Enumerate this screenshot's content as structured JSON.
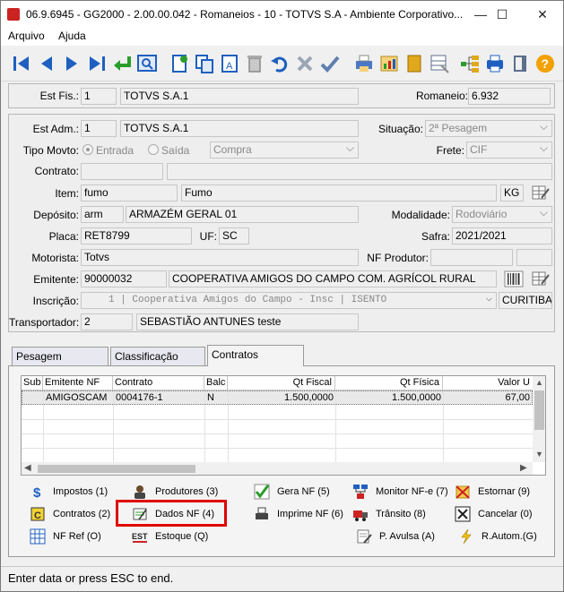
{
  "window": {
    "title": "06.9.6945 - GG2000 - 2.00.00.042 - Romaneios - 10 - TOTVS S.A - Ambiente Corporativo...",
    "minimize": "—",
    "maximize": "☐",
    "close": "✕"
  },
  "menu": {
    "arquivo": "Arquivo",
    "ajuda": "Ajuda"
  },
  "header": {
    "est_fis_label": "Est Fis.:",
    "est_fis_code": "1",
    "est_fis_name": "TOTVS S.A.1",
    "romaneio_label": "Romaneio:",
    "romaneio_value": "6.932"
  },
  "form": {
    "est_adm_label": "Est Adm.:",
    "est_adm_code": "1",
    "est_adm_name": "TOTVS S.A.1",
    "situacao_label": "Situação:",
    "situacao_value": "2ª Pesagem",
    "tipo_movto_label": "Tipo Movto:",
    "entrada_label": "Entrada",
    "saida_label": "Saída",
    "tipo_value": "Compra",
    "frete_label": "Frete:",
    "frete_value": "CIF",
    "contrato_label": "Contrato:",
    "item_label": "Item:",
    "item_code": "fumo",
    "item_name": "Fumo",
    "item_unit": "KG",
    "deposito_label": "Depósito:",
    "deposito_code": "arm",
    "deposito_name": "ARMAZÉM GERAL 01",
    "modalidade_label": "Modalidade:",
    "modalidade_value": "Rodoviário",
    "placa_label": "Placa:",
    "placa_value": "RET8799",
    "uf_label": "UF:",
    "uf_value": "SC",
    "safra_label": "Safra:",
    "safra_value": "2021/2021",
    "motorista_label": "Motorista:",
    "motorista_value": "Totvs",
    "nf_produtor_label": "NF Produtor:",
    "emitente_label": "Emitente:",
    "emitente_code": "90000032",
    "emitente_name": "COOPERATIVA AMIGOS DO CAMPO COM. AGRÍCOL RURAL",
    "inscricao_label": "Inscrição:",
    "inscricao_value": "1 | Cooperativa Amigos do Campo - Insc | ISENTO",
    "cidade_value": "CURITIBA",
    "transportador_label": "Transportador:",
    "transportador_code": "2",
    "transportador_name": "SEBASTIÃO ANTUNES teste"
  },
  "tabs": [
    "Pesagem",
    "Classificação",
    "Contratos"
  ],
  "grid": {
    "columns": [
      "Sub",
      "Emitente NF",
      "Contrato",
      "Balc",
      "Qt Fiscal",
      "Qt Física",
      "Valor U"
    ],
    "rows": [
      [
        "",
        "AMIGOSCAM",
        "0004176-1",
        "N",
        "1.500,0000",
        "1.500,0000",
        "67,00"
      ]
    ]
  },
  "actions": [
    {
      "label": "Impostos (1)"
    },
    {
      "label": "Produtores (3)"
    },
    {
      "label": "Gera NF (5)"
    },
    {
      "label": "Monitor NF-e (7)"
    },
    {
      "label": "Estornar (9)"
    },
    {
      "label": "Contratos (2)"
    },
    {
      "label": "Dados NF (4)"
    },
    {
      "label": "Imprime NF (6)"
    },
    {
      "label": "Trânsito (8)"
    },
    {
      "label": "Cancelar (0)"
    },
    {
      "label": "NF Ref (O)"
    },
    {
      "label": "Estoque (Q)"
    },
    {
      "label": "P. Avulsa (A)"
    },
    {
      "label": "R.Autom.(G)"
    }
  ],
  "est_icon_text": "EST",
  "status": "Enter data or press ESC to end.",
  "colors": {
    "toolbar_blue": "#1f5fbf",
    "highlight": "#e00000",
    "green_check": "#2a9d2a"
  }
}
